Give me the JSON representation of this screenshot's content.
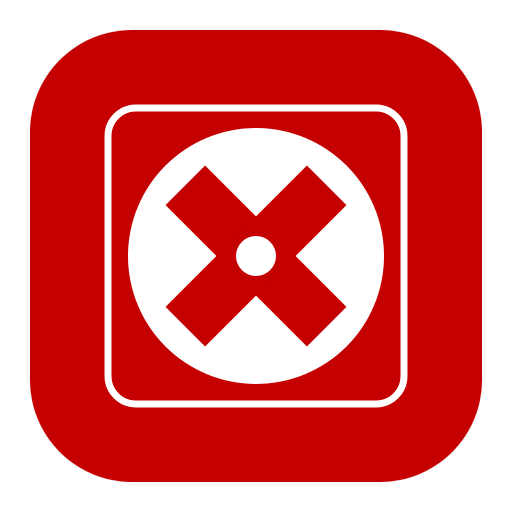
{
  "app_icon": {
    "icon_name": "close-x-icon",
    "colors": {
      "background": "#c40000",
      "foreground": "#ffffff",
      "mark": "#c40000"
    }
  }
}
